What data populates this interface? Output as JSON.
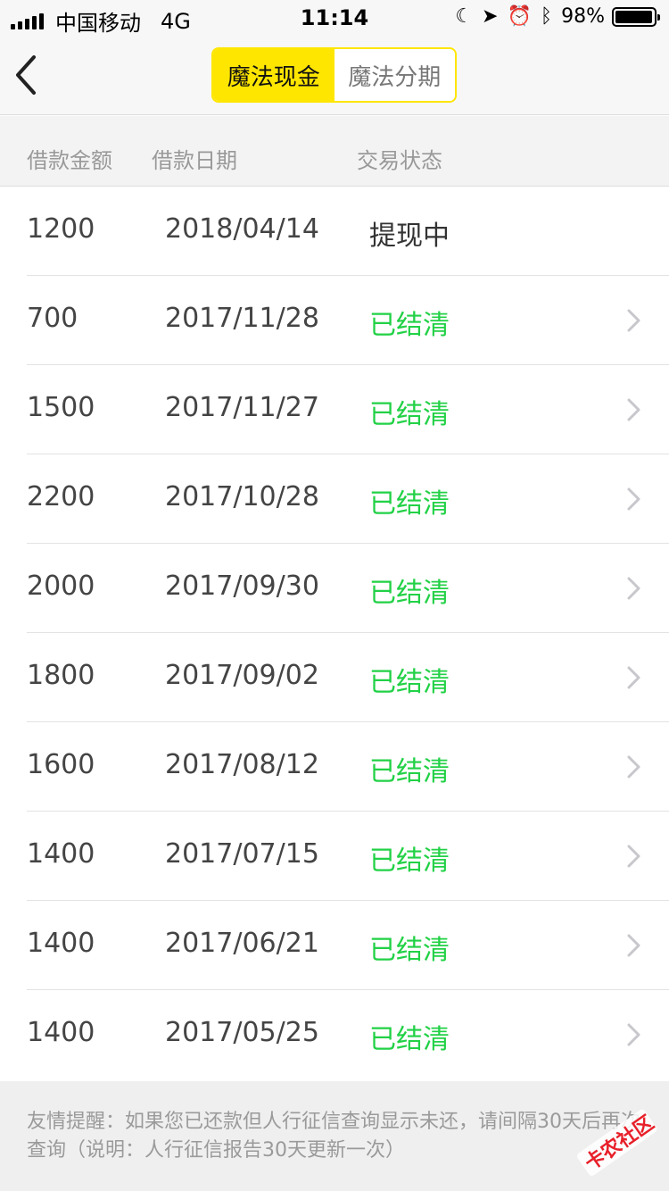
{
  "status_bar": {
    "carrier": "中国移动",
    "network": "4G",
    "time": "11:14",
    "battery": "98%",
    "battery_level": 0.98
  },
  "nav": {
    "back_icon": "chevron-left-icon",
    "tabs": [
      {
        "label": "魔法现金",
        "active": true
      },
      {
        "label": "魔法分期",
        "active": false
      }
    ]
  },
  "table": {
    "headers": [
      "借款金额",
      "借款日期",
      "交易状态"
    ],
    "rows": [
      {
        "amount": "1200",
        "date": "2018/04/14",
        "status": "提现中",
        "type": "pending"
      },
      {
        "amount": "700",
        "date": "2017/11/28",
        "status": "已结清",
        "type": "done"
      },
      {
        "amount": "1500",
        "date": "2017/11/27",
        "status": "已结清",
        "type": "done"
      },
      {
        "amount": "2200",
        "date": "2017/10/28",
        "status": "已结清",
        "type": "done"
      },
      {
        "amount": "2000",
        "date": "2017/09/30",
        "status": "已结清",
        "type": "done"
      },
      {
        "amount": "1800",
        "date": "2017/09/02",
        "status": "已结清",
        "type": "done"
      },
      {
        "amount": "1600",
        "date": "2017/08/12",
        "status": "已结清",
        "type": "done"
      },
      {
        "amount": "1400",
        "date": "2017/07/15",
        "status": "已结清",
        "type": "done"
      },
      {
        "amount": "1400",
        "date": "2017/06/21",
        "status": "已结清",
        "type": "done"
      },
      {
        "amount": "1400",
        "date": "2017/05/25",
        "status": "已结清",
        "type": "done"
      }
    ]
  },
  "footer": {
    "notice": "友情提醒：如果您已还款但人行征信查询显示未还，请间隔30天后再次查询（说明：人行征信报告30天更新一次）"
  },
  "watermark": {
    "text": "卡农社区"
  },
  "colors": {
    "accent_yellow": "#ffe600",
    "settled_green": "#22d146"
  }
}
